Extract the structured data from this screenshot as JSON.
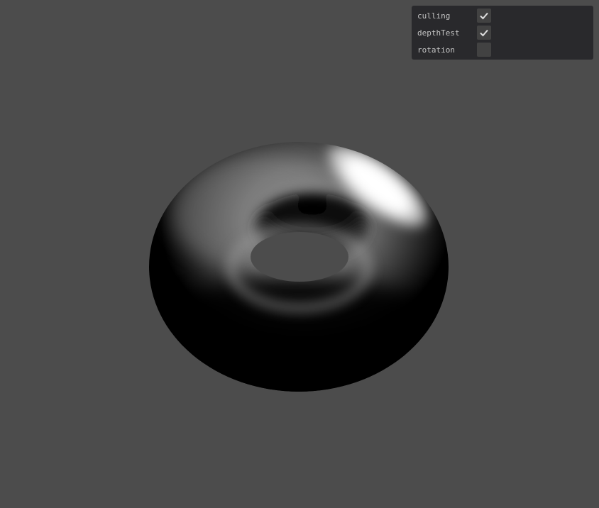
{
  "scene": {
    "background_color": "#4c4c4c",
    "object": "torus"
  },
  "gui": {
    "controls": [
      {
        "label": "culling",
        "checked": true,
        "icon": "check-icon"
      },
      {
        "label": "depthTest",
        "checked": true,
        "icon": "check-icon"
      },
      {
        "label": "rotation",
        "checked": false,
        "icon": "check-icon"
      }
    ]
  }
}
